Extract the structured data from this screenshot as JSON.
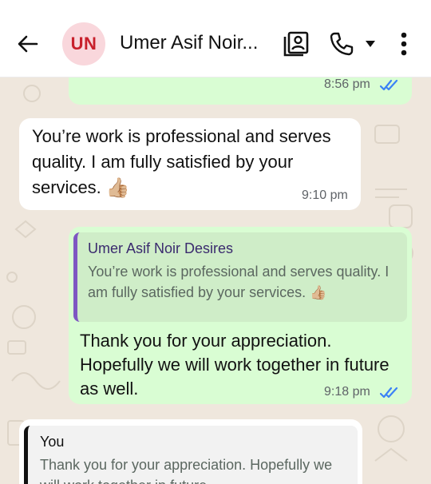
{
  "header": {
    "avatar_initials": "UN",
    "contact_name": "Umer Asif Noir...",
    "icons": [
      "back-arrow-icon",
      "contact-card-icon",
      "phone-icon",
      "caret-down-icon",
      "more-vert-icon"
    ]
  },
  "messages": [
    {
      "direction": "outgoing",
      "time": "8:56 pm",
      "status": "read"
    },
    {
      "direction": "incoming",
      "text": "You’re work is professional and serves quality. I am fully satisfied by your services.",
      "emoji": "👍🏼",
      "time": "9:10 pm"
    },
    {
      "direction": "outgoing",
      "quoted_author": "Umer Asif Noir Desires",
      "quoted_text": "You’re work is professional and serves quality. I am fully satisfied by your services.",
      "quoted_emoji": "👍🏼",
      "text": "Thank you for your appreciation. Hopefully we will work together in future as well.",
      "time": "9:18 pm",
      "status": "read"
    },
    {
      "direction": "incoming",
      "quoted_author": "You",
      "quoted_text": "Thank you for your appreciation. Hopefully we will work together in future"
    }
  ],
  "colors": {
    "outgoing_bubble": "#d9fdd3",
    "incoming_bubble": "#ffffff",
    "chat_background": "#efe7dd",
    "read_ticks": "#3b82f6",
    "avatar_bg": "#f9d7dc",
    "avatar_text": "#c8202c",
    "quote_bar": "#7e57c2"
  }
}
